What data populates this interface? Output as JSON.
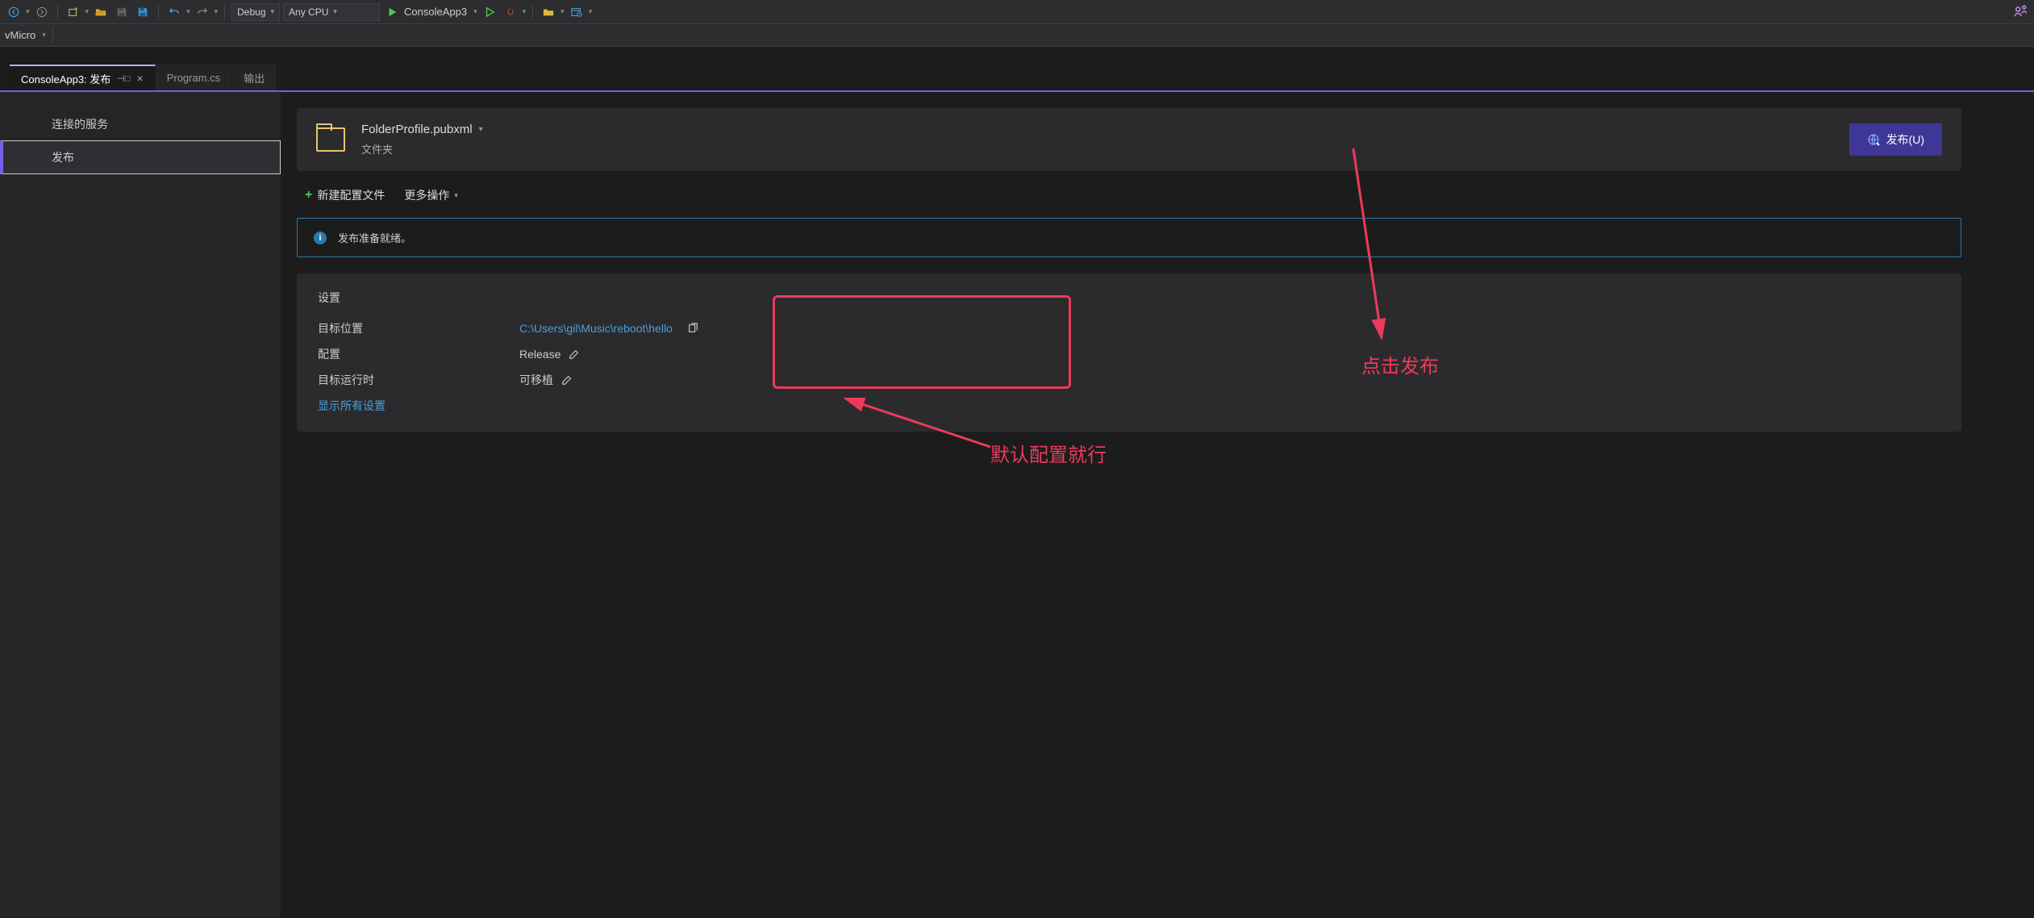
{
  "toolbar": {
    "config": "Debug",
    "platform": "Any CPU",
    "run_target": "ConsoleApp3"
  },
  "toolbar2": {
    "vmicro": "vMicro"
  },
  "tabs": [
    {
      "label": "ConsoleApp3: 发布",
      "active": true
    },
    {
      "label": "Program.cs",
      "active": false
    },
    {
      "label": "输出",
      "active": false
    }
  ],
  "sidebar": {
    "items": [
      {
        "label": "连接的服务",
        "active": false
      },
      {
        "label": "发布",
        "active": true
      }
    ]
  },
  "profile": {
    "name": "FolderProfile.pubxml",
    "type": "文件夹",
    "publish_btn": "发布(U)"
  },
  "actions": {
    "new_profile": "新建配置文件",
    "more": "更多操作"
  },
  "status": {
    "message": "发布准备就绪。"
  },
  "settings": {
    "title": "设置",
    "rows": {
      "target_location": {
        "label": "目标位置",
        "value": "C:\\Users\\gil\\Music\\reboot\\hello"
      },
      "configuration": {
        "label": "配置",
        "value": "Release"
      },
      "target_runtime": {
        "label": "目标运行时",
        "value": "可移植"
      }
    },
    "show_all": "显示所有设置"
  },
  "annotations": {
    "click_publish": "点击发布",
    "default_config": "默认配置就行"
  }
}
